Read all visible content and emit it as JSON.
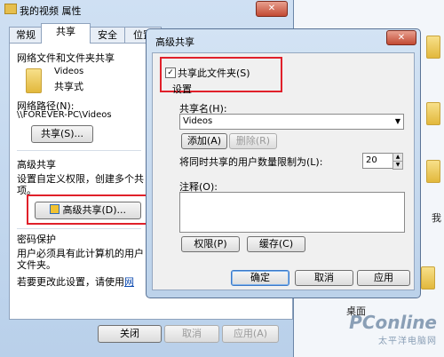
{
  "background": {
    "side_label_1": "我",
    "side_label_2": "桌面"
  },
  "properties_window": {
    "title": "我的视频 属性",
    "close_glyph": "✕",
    "tabs": [
      {
        "label": "常规"
      },
      {
        "label": "共享"
      },
      {
        "label": "安全"
      },
      {
        "label": "位置"
      }
    ],
    "network_section": {
      "heading": "网络文件和文件夹共享",
      "folder_name": "Videos",
      "folder_status": "共享式",
      "path_label": "网络路径(N):",
      "path_value": "\\\\FOREVER-PC\\Videos",
      "share_button": "共享(S)..."
    },
    "advanced_section": {
      "heading": "高级共享",
      "desc_line1": "设置自定义权限，创建多个共",
      "desc_line2": "项。",
      "advanced_button": "高级共享(D)..."
    },
    "password_section": {
      "heading": "密码保护",
      "desc_line1": "用户必须具有此计算机的用户",
      "desc_line2": "文件夹。",
      "change_text": "若要更改此设置，请使用",
      "link_text": "网"
    },
    "buttons": {
      "close": "关闭",
      "cancel": "取消",
      "apply": "应用(A)"
    }
  },
  "advanced_dialog": {
    "title": "高级共享",
    "close_glyph": "✕",
    "share_checkbox": {
      "label": "共享此文件夹(S)",
      "checked": true,
      "glyph": "✓"
    },
    "settings_heading": "设置",
    "share_name_label": "共享名(H):",
    "share_name_value": "Videos",
    "dropdown_glyph": "▼",
    "add_button": "添加(A)",
    "remove_button": "删除(R)",
    "limit_label": "将同时共享的用户数量限制为(L):",
    "limit_value": "20",
    "spin_up": "▲",
    "spin_down": "▼",
    "comment_label": "注释(O):",
    "comment_value": "",
    "permissions_button": "权限(P)",
    "cache_button": "缓存(C)",
    "ok_button": "确定",
    "cancel_button": "取消",
    "apply_button": "应用"
  },
  "watermark": {
    "brand": "PConline",
    "tagline": "太平洋电脑网"
  },
  "colors": {
    "highlight_red": "#e0202a",
    "folder_yellow": "#e6bf4e"
  }
}
